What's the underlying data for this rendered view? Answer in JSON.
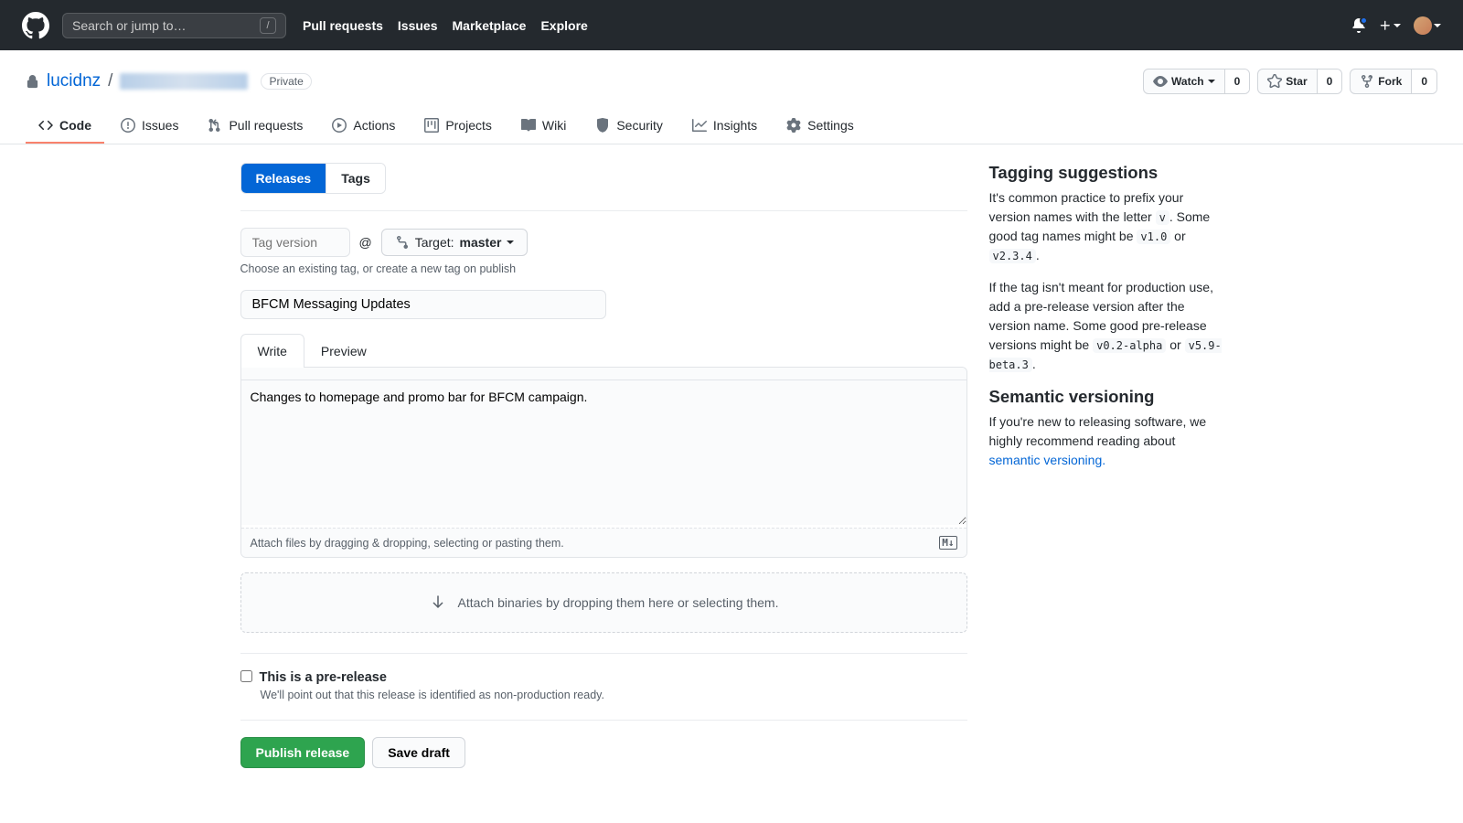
{
  "header": {
    "search_placeholder": "Search or jump to…",
    "search_key": "/",
    "nav": [
      "Pull requests",
      "Issues",
      "Marketplace",
      "Explore"
    ]
  },
  "repo": {
    "owner": "lucidnz",
    "private_badge": "Private",
    "actions": {
      "watch": {
        "label": "Watch",
        "count": "0"
      },
      "star": {
        "label": "Star",
        "count": "0"
      },
      "fork": {
        "label": "Fork",
        "count": "0"
      }
    },
    "tabs": [
      "Code",
      "Issues",
      "Pull requests",
      "Actions",
      "Projects",
      "Wiki",
      "Security",
      "Insights",
      "Settings"
    ]
  },
  "subnav": {
    "releases": "Releases",
    "tags": "Tags"
  },
  "form": {
    "tag_placeholder": "Tag version",
    "at": "@",
    "target_label": "Target:",
    "target_value": "master",
    "tag_hint": "Choose an existing tag, or create a new tag on publish",
    "title_value": "BFCM Messaging Updates",
    "write_tab": "Write",
    "preview_tab": "Preview",
    "body_value": "Changes to homepage and promo bar for BFCM campaign.",
    "attach_hint": "Attach files by dragging & dropping, selecting or pasting them.",
    "md_badge": "M↓",
    "dropzone": "Attach binaries by dropping them here or selecting them.",
    "prerelease_label": "This is a pre-release",
    "prerelease_hint": "We'll point out that this release is identified as non-production ready.",
    "publish": "Publish release",
    "save_draft": "Save draft"
  },
  "sidebar": {
    "tagging_title": "Tagging suggestions",
    "tagging_p1a": "It's common practice to prefix your version names with the letter ",
    "tagging_p1_code1": "v",
    "tagging_p1b": ". Some good tag names might be ",
    "tagging_p1_code2": "v1.0",
    "tagging_p1c": " or ",
    "tagging_p1_code3": "v2.3.4",
    "tagging_p1d": ".",
    "tagging_p2a": "If the tag isn't meant for production use, add a pre-release version after the version name. Some good pre-release versions might be ",
    "tagging_p2_code1": "v0.2-alpha",
    "tagging_p2b": " or ",
    "tagging_p2_code2": "v5.9-beta.3",
    "tagging_p2c": ".",
    "semver_title": "Semantic versioning",
    "semver_p_a": "If you're new to releasing software, we highly recommend reading about ",
    "semver_link": "semantic versioning.",
    "semver_p_b": ""
  }
}
